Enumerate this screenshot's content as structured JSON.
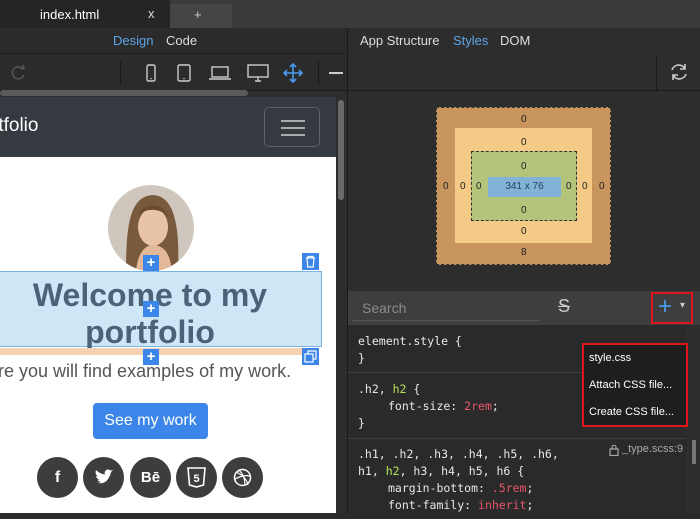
{
  "tabs": [
    {
      "label": "index.html",
      "close": "x"
    },
    {
      "label": "+"
    }
  ],
  "editor_modes": {
    "design": "Design",
    "code": "Code",
    "active": "Design"
  },
  "preview": {
    "brand": "rtfolio",
    "heading": "Welcome to my portfolio",
    "lead": "ere you will find examples of my work.",
    "cta": "See my work",
    "social": [
      "f",
      "twitter",
      "Bē",
      "5",
      "dribbble"
    ],
    "add_symbol": "+"
  },
  "panel_tabs": {
    "app_structure": "App Structure",
    "styles": "Styles",
    "dom": "DOM",
    "active": "Styles"
  },
  "box_model": {
    "margin": {
      "top": "0",
      "right": "0",
      "bottom": "8",
      "left": "0"
    },
    "border": {
      "top": "0",
      "right": "0",
      "bottom": "0",
      "left": "0"
    },
    "padding": {
      "top": "0",
      "right": "0",
      "bottom": "0",
      "left": "0"
    },
    "content": "341 x 76"
  },
  "search": {
    "placeholder": "Search",
    "strike_glyph": "S"
  },
  "add_button": {
    "plus": "+",
    "caret": "▾"
  },
  "dropdown": [
    "style.css",
    "Attach CSS file...",
    "Create CSS file..."
  ],
  "css_rules": {
    "r1_selector": "element.style {",
    "r1_close": "}",
    "r2_sel_a": ".h2, ",
    "r2_sel_b": "h2",
    "r2_sel_c": " {",
    "r2_prop": "font-size: ",
    "r2_val": "2rem",
    "r2_semi": ";",
    "r2_close": "}",
    "r3_sel1": ".h1, .h2, .h3, .h4, .h5, .h6,",
    "r3_sel2a": "h1, ",
    "r3_sel2b": "h2",
    "r3_sel2c": ", h3, h4, h5, h6 {",
    "r3_p1": "margin-bottom: ",
    "r3_v1": ".5rem",
    "r3_p2": "font-family: ",
    "r3_v2": "inherit",
    "r3_file": "_type.scss:9"
  },
  "colors": {
    "accent": "#3b86e8",
    "highlight_border": "#e0161d",
    "active_tab": "#5ea5e8"
  }
}
